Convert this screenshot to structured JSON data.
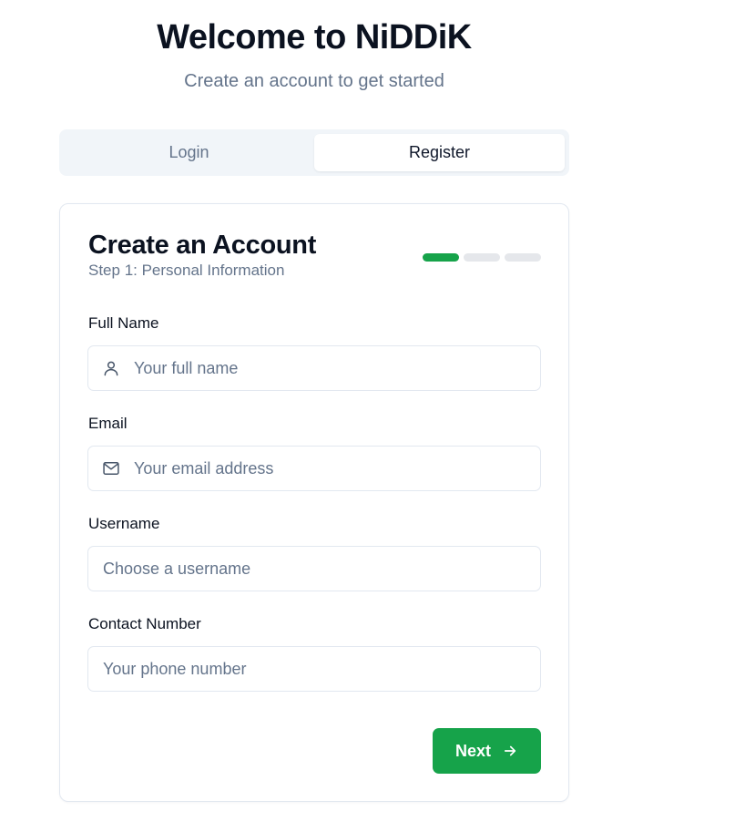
{
  "header": {
    "title": "Welcome to NiDDiK",
    "subtitle": "Create an account to get started"
  },
  "tabs": [
    {
      "label": "Login",
      "active": false
    },
    {
      "label": "Register",
      "active": true
    }
  ],
  "card": {
    "title": "Create an Account",
    "subtitle": "Step 1: Personal Information",
    "progress": {
      "current_step": 1,
      "total_steps": 3,
      "active_color": "#16a34a"
    }
  },
  "form": {
    "full_name": {
      "label": "Full Name",
      "placeholder": "Your full name",
      "value": "",
      "icon": "user-icon"
    },
    "email": {
      "label": "Email",
      "placeholder": "Your email address",
      "value": "",
      "icon": "mail-icon"
    },
    "username": {
      "label": "Username",
      "placeholder": "Choose a username",
      "value": ""
    },
    "contact": {
      "label": "Contact Number",
      "placeholder": "Your phone number",
      "value": ""
    }
  },
  "actions": {
    "next_label": "Next",
    "next_icon": "arrow-right-icon",
    "accent": "#16a34a"
  }
}
